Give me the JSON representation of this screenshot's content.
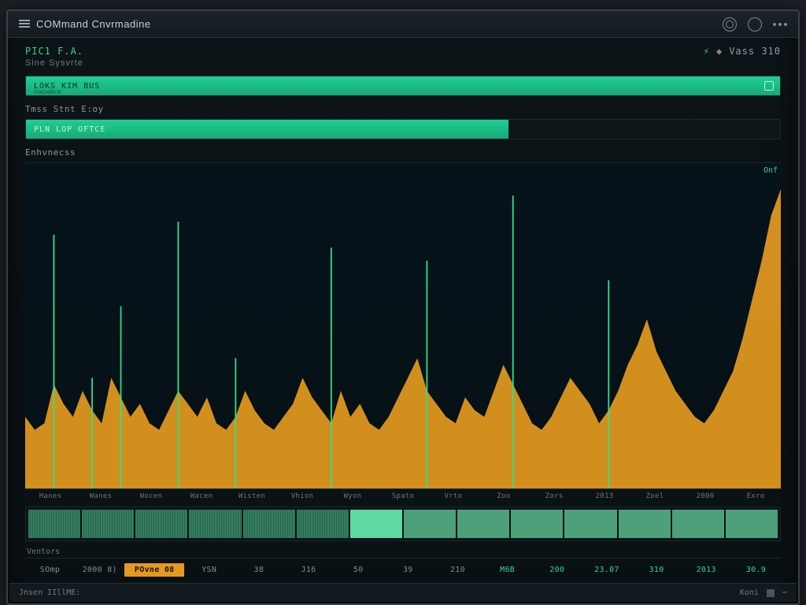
{
  "titlebar": {
    "app_name": "COMmand Cnvrmadine",
    "icons": {
      "gear": "gear-icon",
      "clock": "clock-icon",
      "menu": "menu-icon"
    }
  },
  "status": {
    "proc_id": "PIC1 F.A.",
    "sys_line": "Sine Sysvrte",
    "right_label": "Vass 310",
    "right_icon": "bolt-icon"
  },
  "bars": [
    {
      "label": "LOKS KIM bus",
      "sublabel": "nocodece",
      "percent": 100,
      "icon": "expand-icon"
    },
    {
      "section": "Tmss Stnt E:oy",
      "label": "Pln lop Oftce",
      "percent": 64
    }
  ],
  "chart_label_left": "Enhvnecss",
  "chart_label_right": "Onf",
  "chart_data": {
    "type": "area",
    "title": "",
    "xlabel": "",
    "ylabel": "",
    "ylim": [
      0,
      100
    ],
    "x_ticks": [
      "Hanes",
      "Wanes",
      "Wocen",
      "Wacen",
      "Wisten",
      "Vhion",
      "Wyon",
      "Spato",
      "Vrto",
      "Zoo",
      "Zors",
      "2013",
      "Zoel",
      "2000",
      "Exro"
    ],
    "series": [
      {
        "name": "load",
        "color": "#e59a1f",
        "values": [
          22,
          18,
          20,
          32,
          26,
          22,
          30,
          24,
          20,
          34,
          28,
          22,
          26,
          20,
          18,
          24,
          30,
          26,
          22,
          28,
          20,
          18,
          22,
          30,
          24,
          20,
          18,
          22,
          26,
          34,
          28,
          24,
          20,
          30,
          22,
          26,
          20,
          18,
          22,
          28,
          34,
          40,
          30,
          26,
          22,
          20,
          28,
          24,
          22,
          30,
          38,
          32,
          26,
          20,
          18,
          22,
          28,
          34,
          30,
          26,
          20,
          24,
          30,
          38,
          44,
          52,
          42,
          36,
          30,
          26,
          22,
          20,
          24,
          30,
          36,
          46,
          58,
          70,
          84,
          92
        ]
      },
      {
        "name": "spikes",
        "color": "#2fe08a",
        "values": [
          0,
          0,
          0,
          78,
          0,
          0,
          0,
          34,
          0,
          0,
          56,
          0,
          0,
          0,
          0,
          0,
          82,
          0,
          0,
          0,
          0,
          0,
          40,
          0,
          0,
          0,
          0,
          0,
          0,
          0,
          0,
          0,
          74,
          0,
          0,
          0,
          0,
          0,
          0,
          0,
          0,
          0,
          70,
          0,
          0,
          0,
          0,
          0,
          0,
          0,
          0,
          90,
          0,
          0,
          0,
          0,
          0,
          0,
          0,
          0,
          0,
          64,
          0,
          0,
          0,
          0,
          0,
          0,
          0,
          0,
          0,
          0,
          0,
          0,
          0,
          0,
          0,
          0,
          0,
          0
        ]
      }
    ]
  },
  "numstrip": {
    "label": "Ventors",
    "cells": [
      {
        "text": "SOmp",
        "kind": "plain"
      },
      {
        "text": "2000 8)",
        "kind": "plain"
      },
      {
        "text": "POvne 08",
        "kind": "hl"
      },
      {
        "text": "YSN",
        "kind": "plain"
      },
      {
        "text": "38",
        "kind": "plain"
      },
      {
        "text": "J16",
        "kind": "plain"
      },
      {
        "text": "50",
        "kind": "plain"
      },
      {
        "text": "39",
        "kind": "plain"
      },
      {
        "text": "210",
        "kind": "plain"
      },
      {
        "text": "M6B",
        "kind": "grn"
      },
      {
        "text": "200",
        "kind": "grn"
      },
      {
        "text": "23.07",
        "kind": "grn"
      },
      {
        "text": "310",
        "kind": "grn"
      },
      {
        "text": "2013",
        "kind": "grn"
      },
      {
        "text": "30.9",
        "kind": "grn"
      }
    ]
  },
  "statusbar": {
    "left": "Jnsen IIllME:",
    "right": "Koni"
  },
  "colors": {
    "accent_green": "#1fcf93",
    "accent_orange": "#e59a1f",
    "bg_dark": "#0a1115"
  }
}
